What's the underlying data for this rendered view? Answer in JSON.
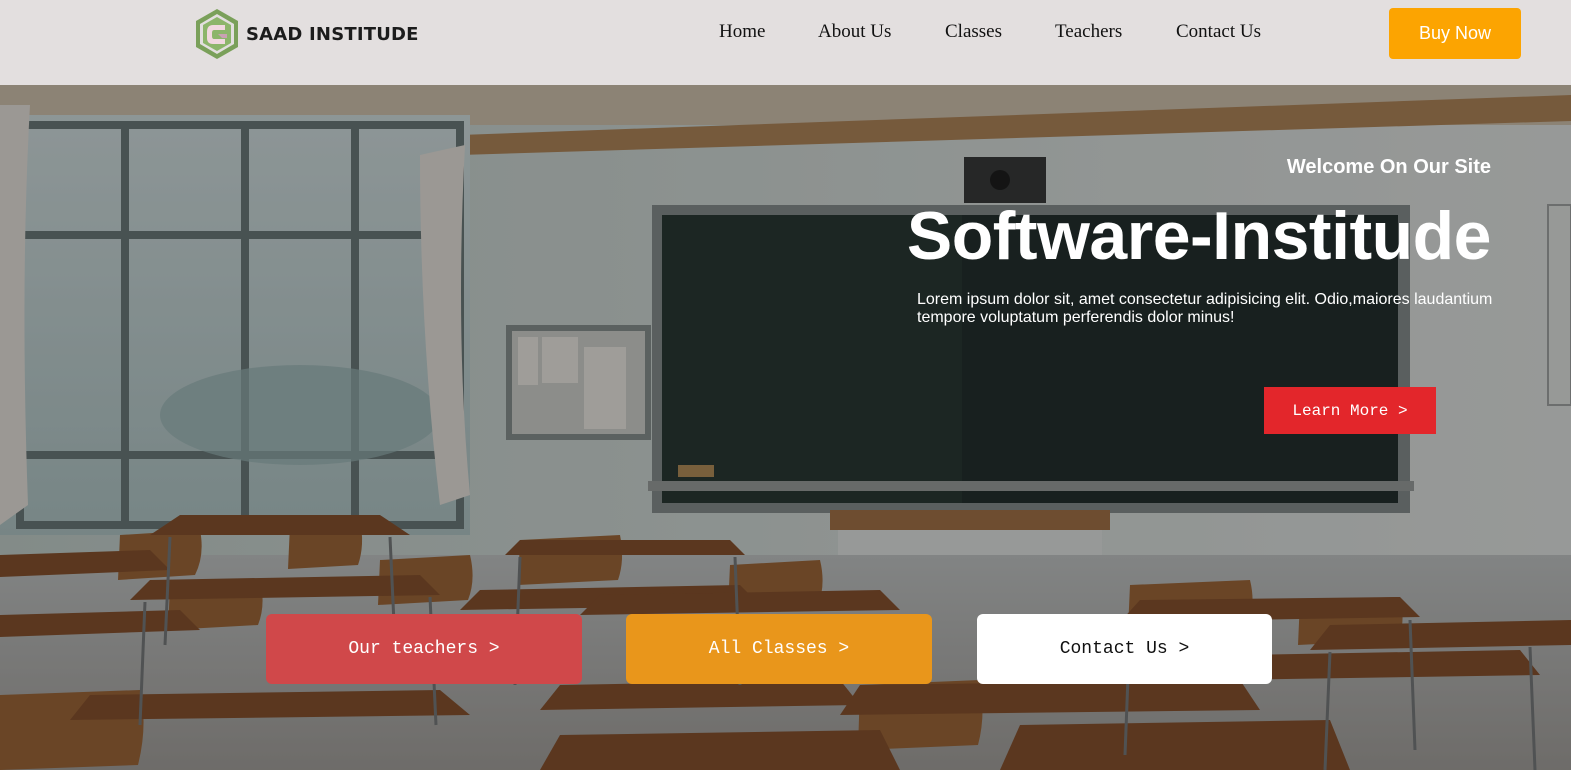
{
  "brand": {
    "name": "SAAD INSTITUDE",
    "logo_icon": "hexagon-c-logo-icon"
  },
  "nav": {
    "items": [
      "Home",
      "About Us",
      "Classes",
      "Teachers",
      "Contact Us"
    ],
    "buy_label": "Buy Now"
  },
  "hero": {
    "welcome": "Welcome On Our Site",
    "title": "Software-Institude",
    "description": "Lorem ipsum dolor sit, amet consectetur adipisicing elit. Odio,maiores laudantium tempore voluptatum perferendis dolor minus!",
    "learn_more": "Learn More >",
    "background": "classroom-illustration"
  },
  "cta": {
    "teachers": "Our teachers >",
    "classes": "All Classes >",
    "contact": "Contact Us >"
  },
  "colors": {
    "header_bg": "#e3dfdf",
    "buy_button": "#fca401",
    "learn_button": "#e3262b",
    "teachers_button": "#d0484a",
    "classes_button": "#e9961b",
    "contact_button": "#ffffff"
  }
}
